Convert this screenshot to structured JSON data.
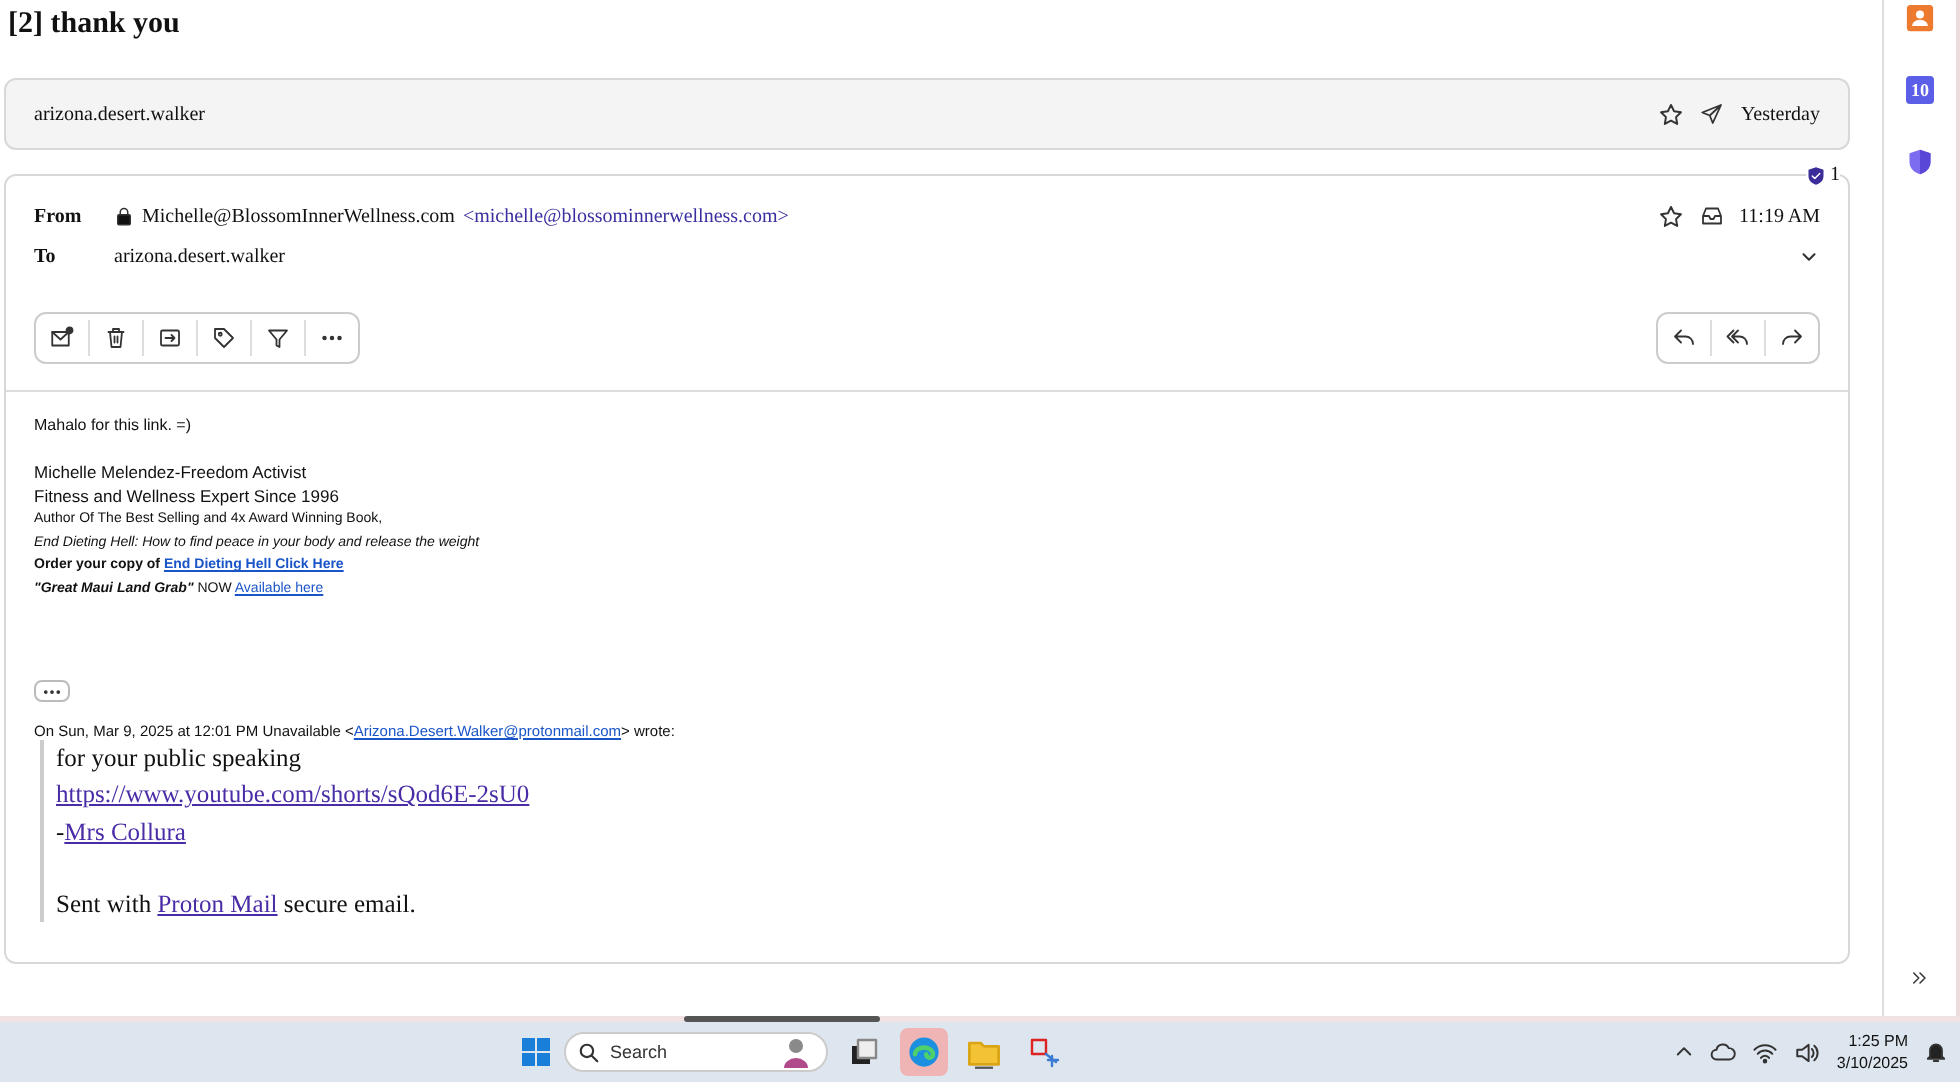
{
  "title": "[2] thank you",
  "collapsed_message": {
    "recipient": "arizona.desert.walker",
    "starred": false,
    "date": "Yesterday"
  },
  "message": {
    "badge_count": "1",
    "from_label": "From",
    "sender_name": "Michelle@BlossomInnerWellness.com",
    "sender_address": "<michelle@blossominnerwellness.com>",
    "to_label": "To",
    "recipient": "arizona.desert.walker",
    "starred": false,
    "time": "11:19 AM",
    "body": {
      "greeting": "Mahalo for this link. =)",
      "signature": [
        {
          "kind": "large",
          "text": "Michelle Melendez-Freedom Activist"
        },
        {
          "kind": "large",
          "text": "Fitness and Wellness Expert Since 1996"
        },
        {
          "kind": "small",
          "text": "Author Of The Best Selling and 4x Award Winning Book,"
        },
        {
          "kind": "italic",
          "text": "End Dieting Hell: How to find peace in your body and release the weight"
        },
        {
          "kind": "bold",
          "text": "Order your copy of ",
          "link": "End Dieting Hell Click Here"
        },
        {
          "kind": "small",
          "text": "**\"Great Maui Land Grab\"** NOW ",
          "link": "Available here"
        }
      ],
      "quote_header": {
        "before": "On Sun, Mar 9, 2025 at 12:01 PM Unavailable <",
        "link": "Arizona.Desert.Walker@protonmail.com",
        "after": "> wrote:"
      },
      "quote_lines": [
        {
          "text": "for your public speaking"
        },
        {
          "link": "https://www.youtube.com/shorts/sQod6E-2sU0"
        },
        {
          "text": "-",
          "link": "Mrs Collura"
        },
        {
          "kind": "blank"
        },
        {
          "text": "Sent with ",
          "link": "Proton Mail",
          "after": " secure email."
        }
      ]
    }
  },
  "sidebar": {
    "calendar_day": "10"
  },
  "taskbar": {
    "search": {
      "placeholder": "Search"
    },
    "apps": [
      {
        "kind": "taskview",
        "selected": false
      },
      {
        "kind": "edge",
        "selected": true
      },
      {
        "kind": "folder",
        "selected": false
      },
      {
        "kind": "tool",
        "selected": false
      }
    ],
    "time": "1:25 PM",
    "date": "3/10/2025"
  }
}
